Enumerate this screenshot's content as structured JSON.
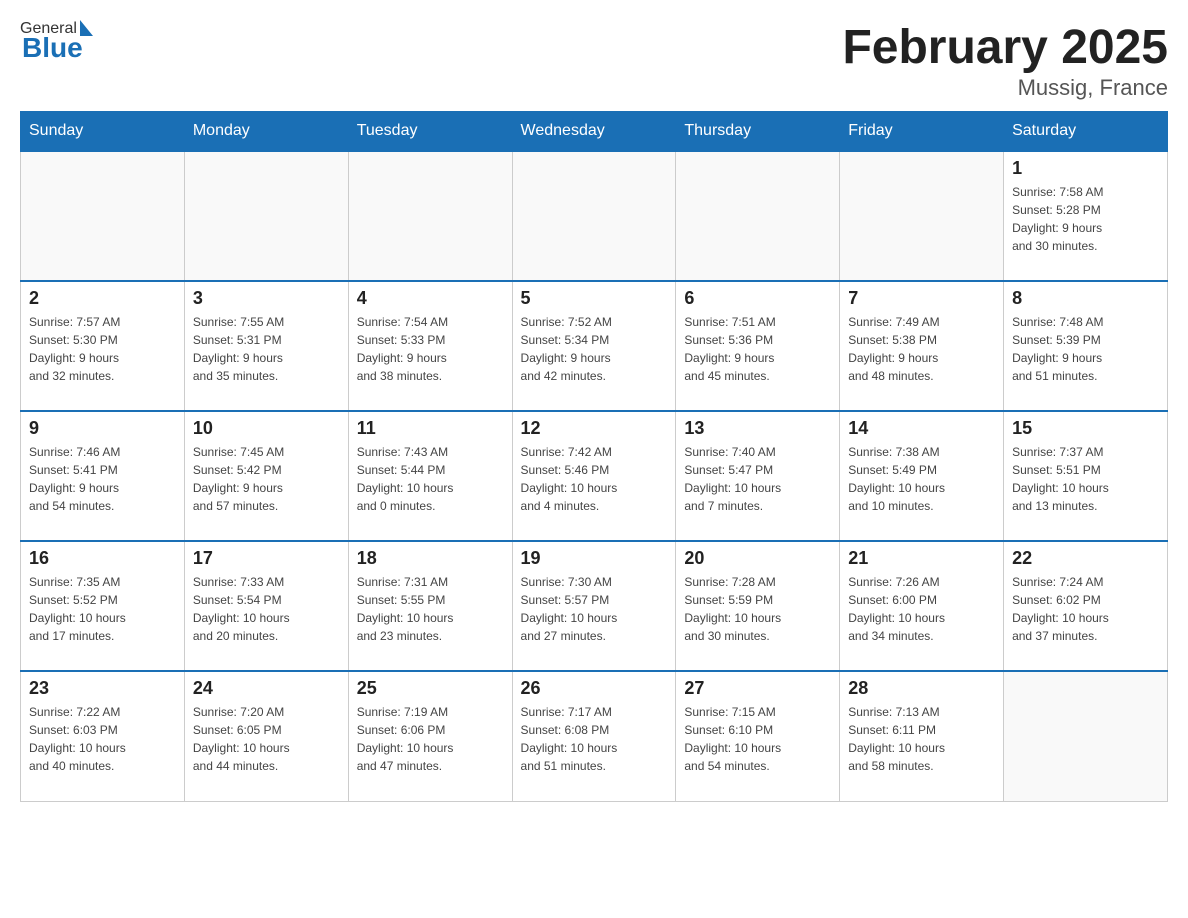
{
  "header": {
    "logo_general": "General",
    "logo_blue": "Blue",
    "month_title": "February 2025",
    "location": "Mussig, France"
  },
  "days_of_week": [
    "Sunday",
    "Monday",
    "Tuesday",
    "Wednesday",
    "Thursday",
    "Friday",
    "Saturday"
  ],
  "weeks": [
    {
      "days": [
        {
          "number": "",
          "info": ""
        },
        {
          "number": "",
          "info": ""
        },
        {
          "number": "",
          "info": ""
        },
        {
          "number": "",
          "info": ""
        },
        {
          "number": "",
          "info": ""
        },
        {
          "number": "",
          "info": ""
        },
        {
          "number": "1",
          "info": "Sunrise: 7:58 AM\nSunset: 5:28 PM\nDaylight: 9 hours\nand 30 minutes."
        }
      ]
    },
    {
      "days": [
        {
          "number": "2",
          "info": "Sunrise: 7:57 AM\nSunset: 5:30 PM\nDaylight: 9 hours\nand 32 minutes."
        },
        {
          "number": "3",
          "info": "Sunrise: 7:55 AM\nSunset: 5:31 PM\nDaylight: 9 hours\nand 35 minutes."
        },
        {
          "number": "4",
          "info": "Sunrise: 7:54 AM\nSunset: 5:33 PM\nDaylight: 9 hours\nand 38 minutes."
        },
        {
          "number": "5",
          "info": "Sunrise: 7:52 AM\nSunset: 5:34 PM\nDaylight: 9 hours\nand 42 minutes."
        },
        {
          "number": "6",
          "info": "Sunrise: 7:51 AM\nSunset: 5:36 PM\nDaylight: 9 hours\nand 45 minutes."
        },
        {
          "number": "7",
          "info": "Sunrise: 7:49 AM\nSunset: 5:38 PM\nDaylight: 9 hours\nand 48 minutes."
        },
        {
          "number": "8",
          "info": "Sunrise: 7:48 AM\nSunset: 5:39 PM\nDaylight: 9 hours\nand 51 minutes."
        }
      ]
    },
    {
      "days": [
        {
          "number": "9",
          "info": "Sunrise: 7:46 AM\nSunset: 5:41 PM\nDaylight: 9 hours\nand 54 minutes."
        },
        {
          "number": "10",
          "info": "Sunrise: 7:45 AM\nSunset: 5:42 PM\nDaylight: 9 hours\nand 57 minutes."
        },
        {
          "number": "11",
          "info": "Sunrise: 7:43 AM\nSunset: 5:44 PM\nDaylight: 10 hours\nand 0 minutes."
        },
        {
          "number": "12",
          "info": "Sunrise: 7:42 AM\nSunset: 5:46 PM\nDaylight: 10 hours\nand 4 minutes."
        },
        {
          "number": "13",
          "info": "Sunrise: 7:40 AM\nSunset: 5:47 PM\nDaylight: 10 hours\nand 7 minutes."
        },
        {
          "number": "14",
          "info": "Sunrise: 7:38 AM\nSunset: 5:49 PM\nDaylight: 10 hours\nand 10 minutes."
        },
        {
          "number": "15",
          "info": "Sunrise: 7:37 AM\nSunset: 5:51 PM\nDaylight: 10 hours\nand 13 minutes."
        }
      ]
    },
    {
      "days": [
        {
          "number": "16",
          "info": "Sunrise: 7:35 AM\nSunset: 5:52 PM\nDaylight: 10 hours\nand 17 minutes."
        },
        {
          "number": "17",
          "info": "Sunrise: 7:33 AM\nSunset: 5:54 PM\nDaylight: 10 hours\nand 20 minutes."
        },
        {
          "number": "18",
          "info": "Sunrise: 7:31 AM\nSunset: 5:55 PM\nDaylight: 10 hours\nand 23 minutes."
        },
        {
          "number": "19",
          "info": "Sunrise: 7:30 AM\nSunset: 5:57 PM\nDaylight: 10 hours\nand 27 minutes."
        },
        {
          "number": "20",
          "info": "Sunrise: 7:28 AM\nSunset: 5:59 PM\nDaylight: 10 hours\nand 30 minutes."
        },
        {
          "number": "21",
          "info": "Sunrise: 7:26 AM\nSunset: 6:00 PM\nDaylight: 10 hours\nand 34 minutes."
        },
        {
          "number": "22",
          "info": "Sunrise: 7:24 AM\nSunset: 6:02 PM\nDaylight: 10 hours\nand 37 minutes."
        }
      ]
    },
    {
      "days": [
        {
          "number": "23",
          "info": "Sunrise: 7:22 AM\nSunset: 6:03 PM\nDaylight: 10 hours\nand 40 minutes."
        },
        {
          "number": "24",
          "info": "Sunrise: 7:20 AM\nSunset: 6:05 PM\nDaylight: 10 hours\nand 44 minutes."
        },
        {
          "number": "25",
          "info": "Sunrise: 7:19 AM\nSunset: 6:06 PM\nDaylight: 10 hours\nand 47 minutes."
        },
        {
          "number": "26",
          "info": "Sunrise: 7:17 AM\nSunset: 6:08 PM\nDaylight: 10 hours\nand 51 minutes."
        },
        {
          "number": "27",
          "info": "Sunrise: 7:15 AM\nSunset: 6:10 PM\nDaylight: 10 hours\nand 54 minutes."
        },
        {
          "number": "28",
          "info": "Sunrise: 7:13 AM\nSunset: 6:11 PM\nDaylight: 10 hours\nand 58 minutes."
        },
        {
          "number": "",
          "info": ""
        }
      ]
    }
  ]
}
